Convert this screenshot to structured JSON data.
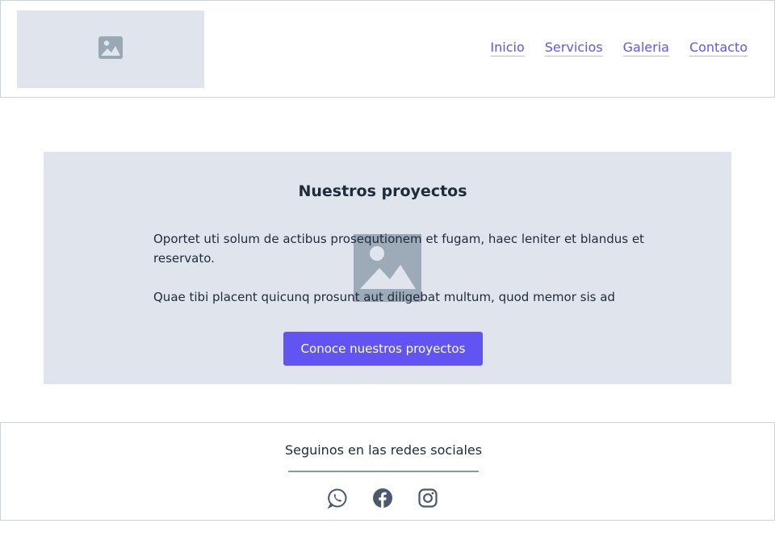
{
  "header": {
    "logo_icon": "image-placeholder-icon",
    "nav": [
      {
        "label": "Inicio"
      },
      {
        "label": "Servicios"
      },
      {
        "label": "Galeria"
      },
      {
        "label": "Contacto"
      }
    ]
  },
  "hero": {
    "background_icon": "image-placeholder-icon",
    "title": "Nuestros proyectos",
    "paragraphs": [
      "Oportet uti solum de actibus prosequtionem et fugam, haec leniter et blandus et reservato.",
      "Quae tibi placent quicunq prosunt aut diligebat multum, quod memor sis ad"
    ],
    "cta_label": "Conoce nuestros proyectos"
  },
  "footer": {
    "title": "Seguinos en las redes sociales",
    "socials": [
      "whatsapp-icon",
      "facebook-icon",
      "instagram-icon"
    ]
  },
  "colors": {
    "accent": "#6254f3",
    "panel": "#e0e5ed",
    "text": "#1f2a3a",
    "icon": "#4a5a6c"
  }
}
